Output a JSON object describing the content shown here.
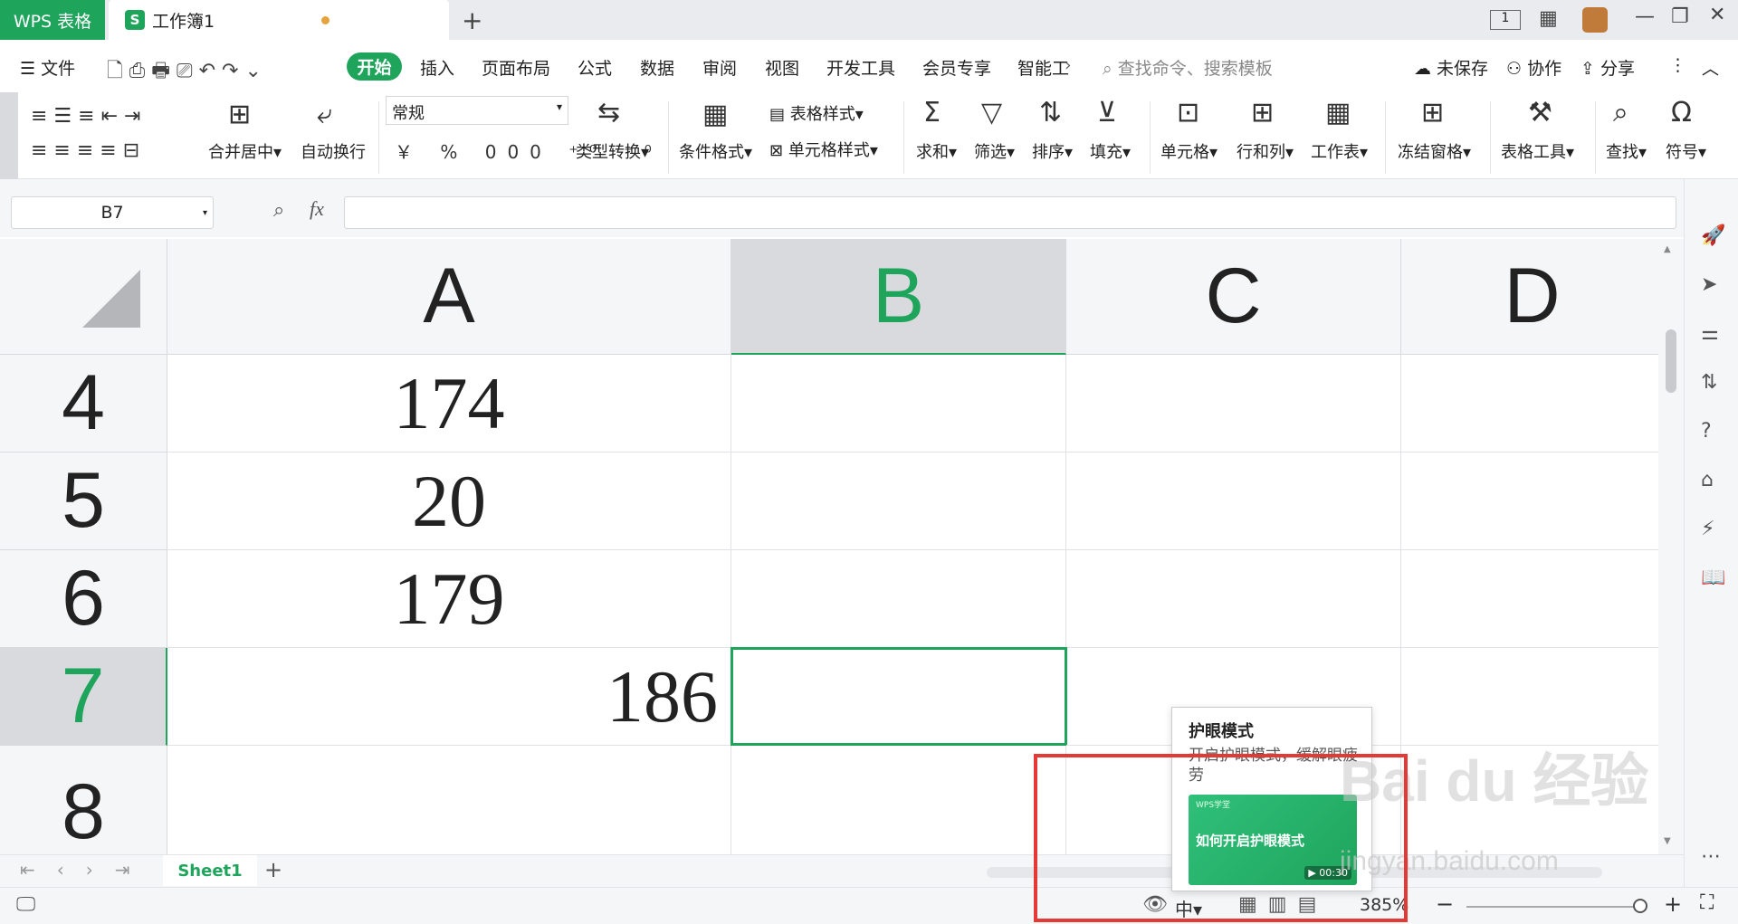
{
  "titlebar": {
    "app_tab": "WPS 表格",
    "doc_tab": "工作簿1",
    "doc_tab_icon": "S",
    "page_indicator": "1"
  },
  "menu": {
    "file": "文件",
    "items": [
      "开始",
      "插入",
      "页面布局",
      "公式",
      "数据",
      "审阅",
      "视图",
      "开发工具",
      "会员专享",
      "智能工"
    ],
    "search_placeholder": "查找命令、搜索模板",
    "unsaved": "未保存",
    "collab": "协作",
    "share": "分享"
  },
  "ribbon": {
    "merge": "合并居中",
    "wrap": "自动换行",
    "format_value": "常规",
    "convert": "类型转换",
    "cond_format": "条件格式",
    "table_style": "表格样式",
    "cell_style": "单元格样式",
    "sum": "求和",
    "filter": "筛选",
    "sort": "排序",
    "fill": "填充",
    "cell": "单元格",
    "rowcol": "行和列",
    "sheet": "工作表",
    "freeze": "冻结窗格",
    "tools": "表格工具",
    "find": "查找",
    "symbol": "符号",
    "currency": "￥",
    "percent": "%",
    "thousands": "000"
  },
  "formula_bar": {
    "name_box": "B7",
    "fx": "fx",
    "value": ""
  },
  "grid": {
    "columns": [
      "A",
      "B",
      "C",
      "D"
    ],
    "rows": [
      {
        "num": "4",
        "a": "174"
      },
      {
        "num": "5",
        "a": "20"
      },
      {
        "num": "6",
        "a": "179"
      },
      {
        "num": "7",
        "a": "186"
      },
      {
        "num": "8",
        "a": ""
      }
    ]
  },
  "sheets": {
    "tabs": [
      "Sheet1"
    ]
  },
  "status": {
    "zoom": "385%",
    "input_mode": "中"
  },
  "popup": {
    "title": "护眼模式",
    "desc": "开启护眼模式，缓解眼疲劳",
    "video_brand": "WPS学堂",
    "video_title": "如何开启护眼模式",
    "duration": "00:30"
  },
  "watermark": {
    "text": "Bai du 经验",
    "url": "jingyan.baidu.com"
  },
  "colors": {
    "accent": "#1fa45c",
    "highlight": "#e53935"
  }
}
